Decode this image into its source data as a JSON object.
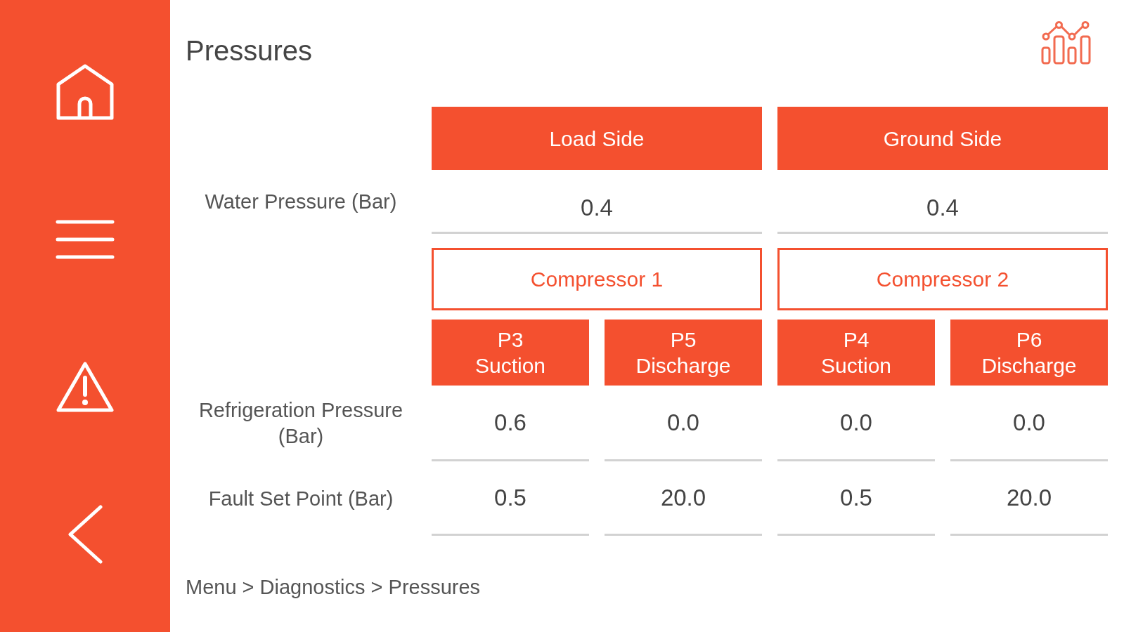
{
  "page": {
    "title": "Pressures"
  },
  "row_labels": {
    "water_pressure": "Water Pressure (Bar)",
    "refrigeration_pressure": "Refrigeration Pressure (Bar)",
    "fault_set_point": "Fault Set Point (Bar)"
  },
  "sides": [
    {
      "header": "Load Side",
      "water_pressure": "0.4",
      "compressor": "Compressor 1",
      "sensors": [
        {
          "label": "P3",
          "sublabel": "Suction",
          "refrigeration_pressure": "0.6",
          "fault_set_point": "0.5"
        },
        {
          "label": "P5",
          "sublabel": "Discharge",
          "refrigeration_pressure": "0.0",
          "fault_set_point": "20.0"
        }
      ]
    },
    {
      "header": "Ground Side",
      "water_pressure": "0.4",
      "compressor": "Compressor 2",
      "sensors": [
        {
          "label": "P4",
          "sublabel": "Suction",
          "refrigeration_pressure": "0.0",
          "fault_set_point": "0.5"
        },
        {
          "label": "P6",
          "sublabel": "Discharge",
          "refrigeration_pressure": "0.0",
          "fault_set_point": "20.0"
        }
      ]
    }
  ],
  "breadcrumb": "Menu > Diagnostics > Pressures"
}
